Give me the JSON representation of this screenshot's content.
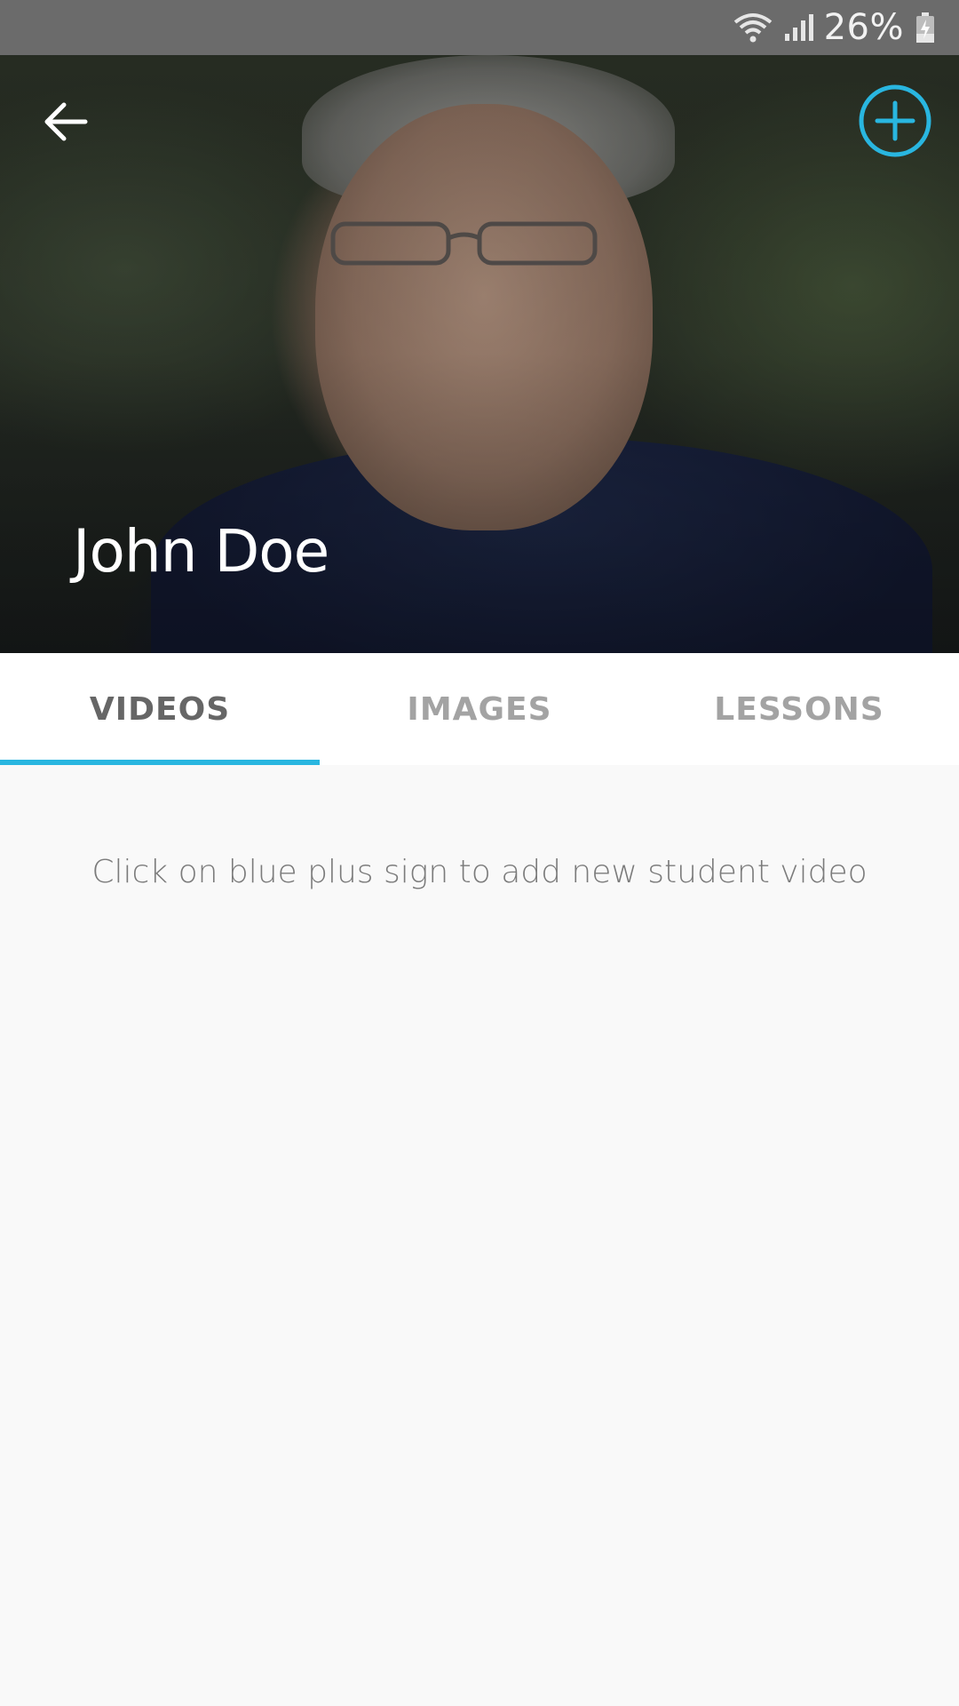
{
  "status_bar": {
    "battery_percent": "26%",
    "icons": [
      "wifi-icon",
      "signal-icon",
      "battery-charging-icon"
    ]
  },
  "header": {
    "student_name": "John Doe",
    "back_icon": "arrow-left-icon",
    "add_icon": "plus-circle-icon",
    "accent_color": "#29b6e0"
  },
  "tabs": [
    {
      "label": "VIDEOS",
      "active": true
    },
    {
      "label": "IMAGES",
      "active": false
    },
    {
      "label": "LESSONS",
      "active": false
    }
  ],
  "content": {
    "empty_message": "Click on blue plus sign to add new student video"
  }
}
